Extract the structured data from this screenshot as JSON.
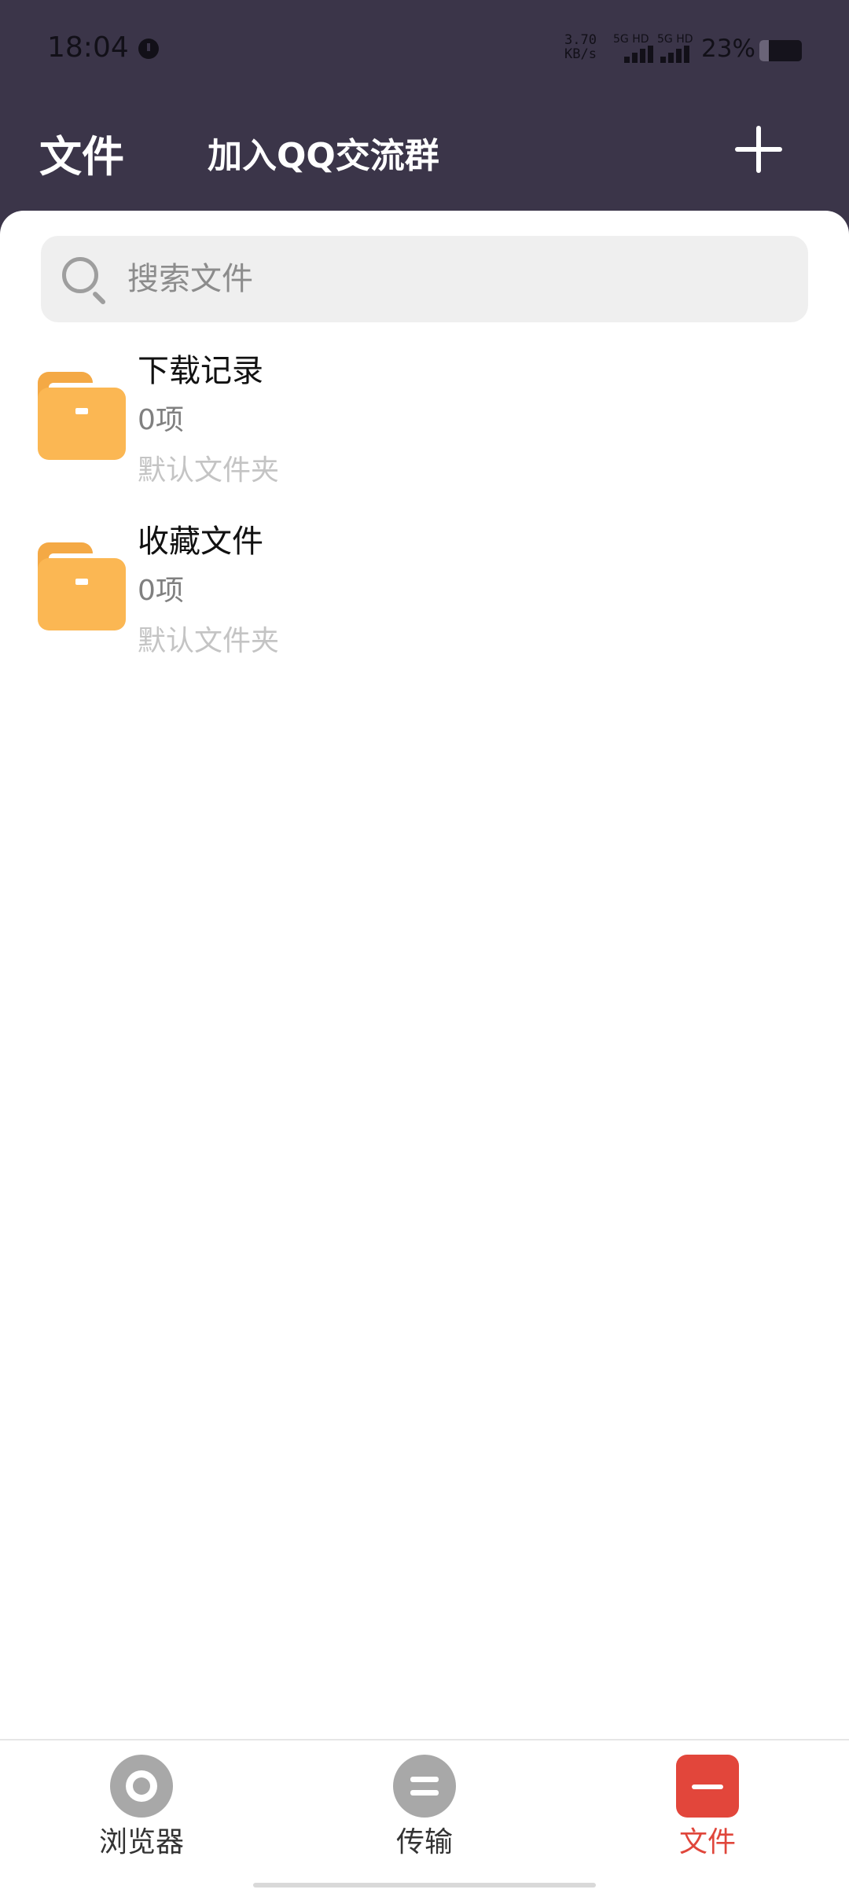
{
  "status_bar": {
    "time": "18:04",
    "net_speed_value": "3.70",
    "net_speed_unit": "KB/s",
    "sim1_label": "5G HD",
    "sim2_label": "5G HD",
    "battery_percent": "23%"
  },
  "header": {
    "title": "文件",
    "qq_group_link": "加入QQ交流群",
    "add_icon": "plus-icon"
  },
  "search": {
    "placeholder": "搜索文件",
    "value": ""
  },
  "folders": [
    {
      "name": "下载记录",
      "count": "0项",
      "description": "默认文件夹",
      "icon": "folder-icon"
    },
    {
      "name": "收藏文件",
      "count": "0项",
      "description": "默认文件夹",
      "icon": "folder-icon"
    }
  ],
  "bottom_nav": {
    "items": [
      {
        "label": "浏览器",
        "icon": "browser-icon",
        "active": false
      },
      {
        "label": "传输",
        "icon": "transfer-icon",
        "active": false
      },
      {
        "label": "文件",
        "icon": "files-icon",
        "active": true
      }
    ],
    "active_color": "#e0463b"
  },
  "colors": {
    "header_bg": "#3b3549",
    "folder_yellow": "#fbb753",
    "accent_red": "#e0463b"
  }
}
